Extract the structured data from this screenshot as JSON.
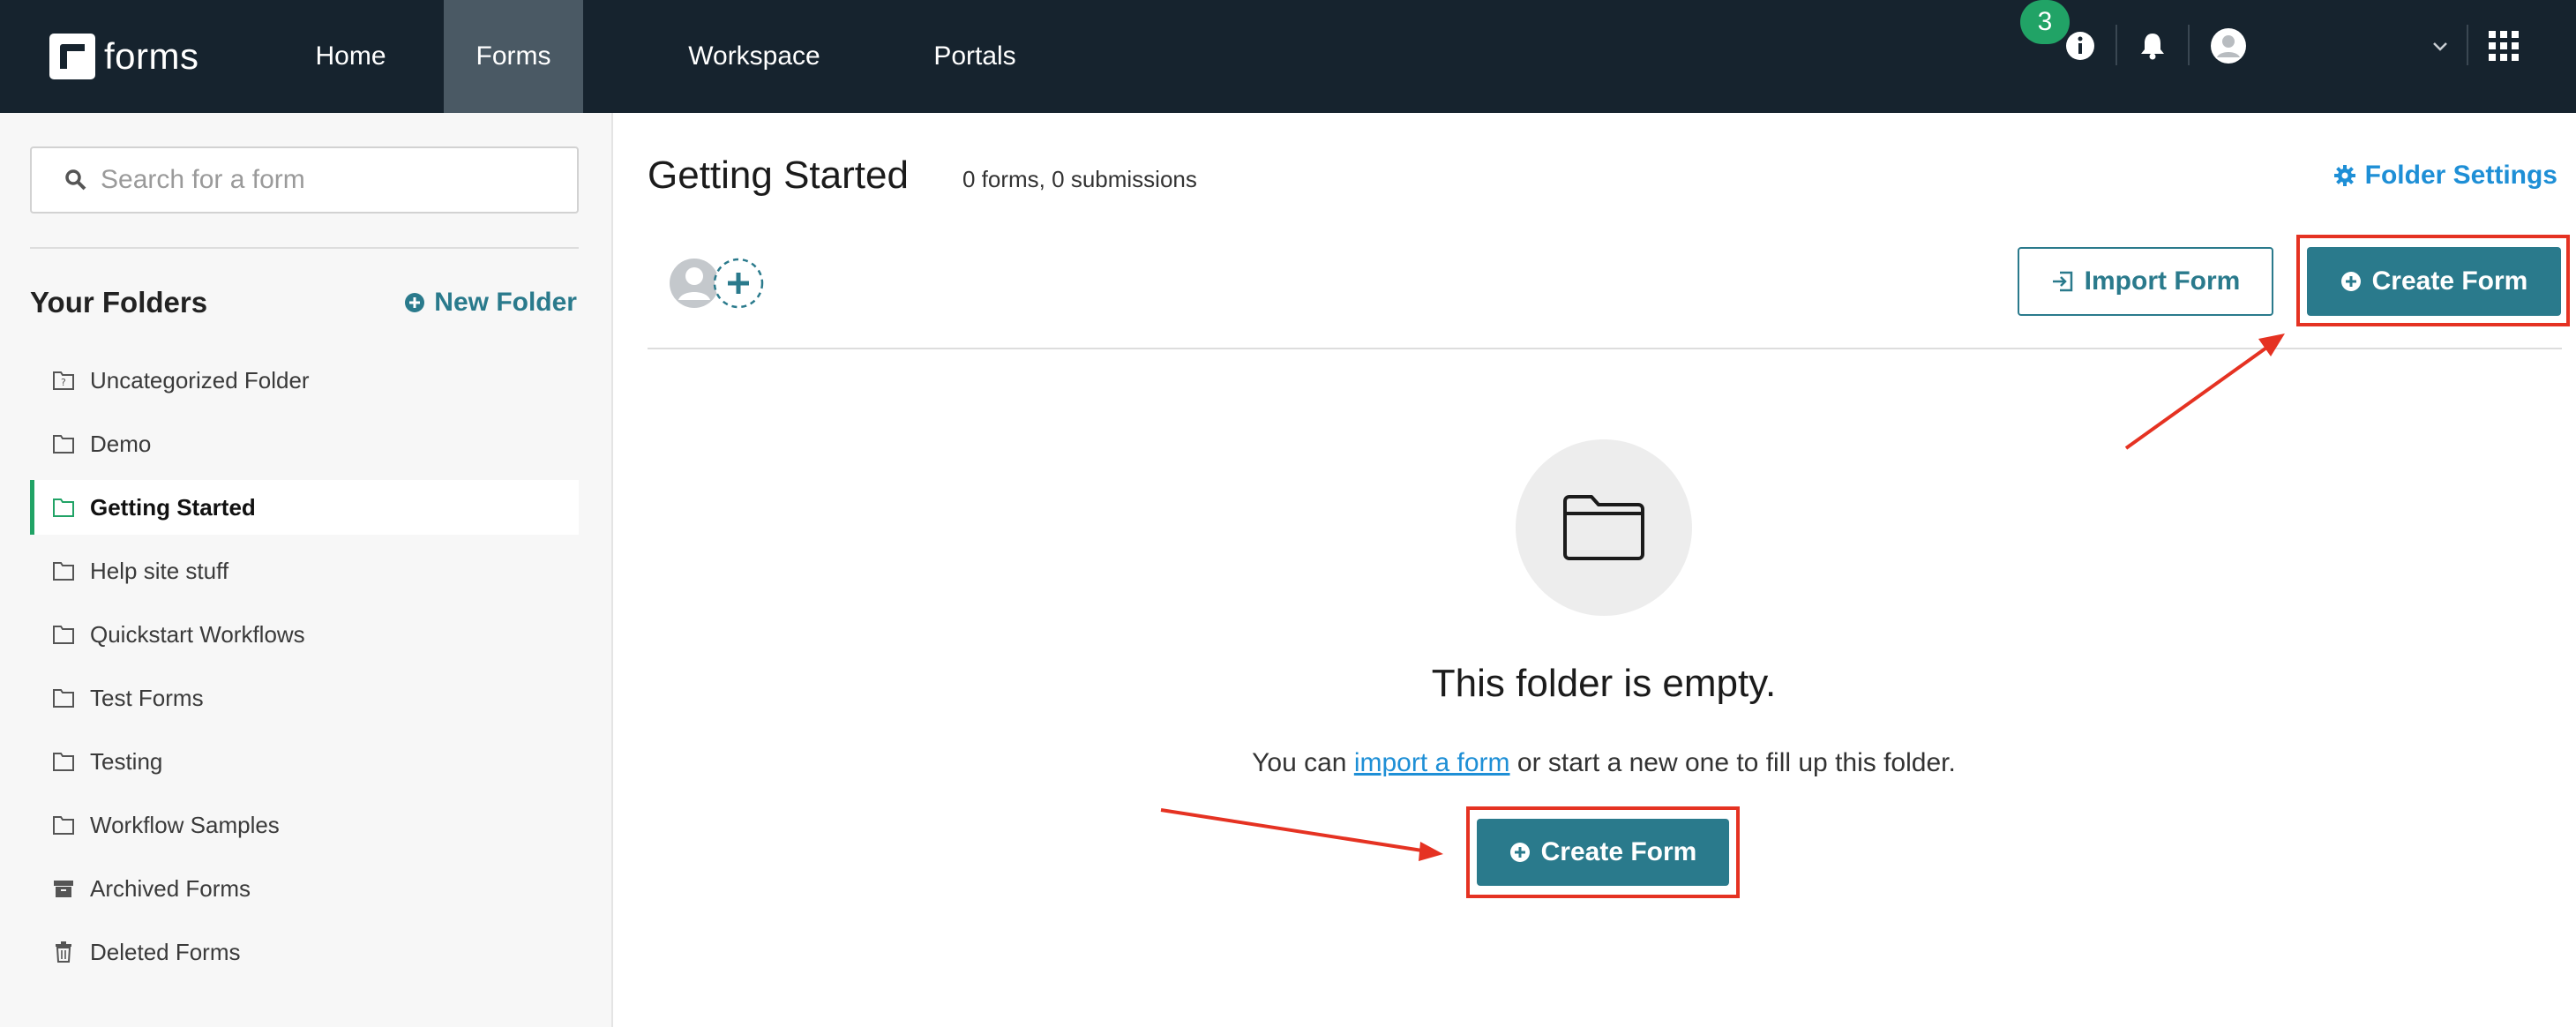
{
  "app": {
    "logo_text": "forms"
  },
  "nav": {
    "items": [
      {
        "label": "Home",
        "active": false
      },
      {
        "label": "Forms",
        "active": true
      },
      {
        "label": "Workspace",
        "active": false
      },
      {
        "label": "Portals",
        "active": false
      }
    ]
  },
  "topbar": {
    "notification_count": "3"
  },
  "sidebar": {
    "search_placeholder": "Search for a form",
    "folders_title": "Your Folders",
    "new_folder_label": "New Folder",
    "folders": [
      {
        "label": "Uncategorized Folder",
        "icon": "uncategorized-folder-icon"
      },
      {
        "label": "Demo",
        "icon": "folder-icon"
      },
      {
        "label": "Getting Started",
        "icon": "folder-icon",
        "active": true
      },
      {
        "label": "Help site stuff",
        "icon": "folder-icon"
      },
      {
        "label": "Quickstart Workflows",
        "icon": "folder-icon"
      },
      {
        "label": "Test Forms",
        "icon": "folder-icon"
      },
      {
        "label": "Testing",
        "icon": "folder-icon"
      },
      {
        "label": "Workflow Samples",
        "icon": "folder-icon"
      },
      {
        "label": "Archived Forms",
        "icon": "archive-icon"
      },
      {
        "label": "Deleted Forms",
        "icon": "trash-icon"
      }
    ]
  },
  "main": {
    "title": "Getting Started",
    "counts": "0 forms, 0 submissions",
    "folder_settings_label": "Folder Settings",
    "import_form_label": "Import Form",
    "create_form_label": "Create Form",
    "empty_title": "This folder is empty.",
    "empty_text_prefix": "You can ",
    "empty_link": "import a form",
    "empty_text_suffix": " or start a new one to fill up this folder.",
    "create_form_center_label": "Create Form"
  },
  "colors": {
    "topbar": "#16232e",
    "nav_active": "#4a5964",
    "badge": "#21a366",
    "primary": "#2a7a8c",
    "link": "#1e8fd6",
    "highlight": "#e53222",
    "active_folder_accent": "#21a366"
  }
}
